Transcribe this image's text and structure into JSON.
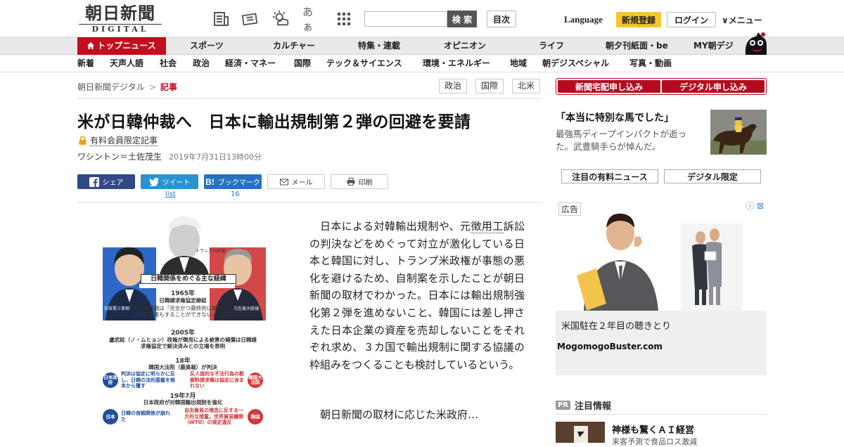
{
  "header": {
    "logo_main": "朝日新聞",
    "logo_sub": "DIGITAL",
    "search_placeholder": "",
    "search_button": "検 索",
    "toc_button": "目次",
    "language": "Language",
    "register": "新規登録",
    "login": "ログイン",
    "menu": "メニュー",
    "font_size_icon_text": "あぁ"
  },
  "main_nav": [
    "トップニュース",
    "スポーツ",
    "カルチャー",
    "特集・連載",
    "オピニオン",
    "ライフ",
    "朝夕刊紙面・be",
    "MY朝デジ"
  ],
  "sub_nav": [
    "新着",
    "天声人語",
    "社会",
    "政治",
    "経済・マネー",
    "国際",
    "テック＆サイエンス",
    "環境・エネルギー",
    "地域",
    "朝デジスペシャル",
    "写真・動画"
  ],
  "breadcrumb": {
    "home": "朝日新聞デジタル",
    "separator": ">",
    "current": "記事"
  },
  "tags": [
    "政治",
    "国際",
    "北米"
  ],
  "subscribe": {
    "newspaper": "新聞宅配申し込み",
    "digital": "デジタル申し込み"
  },
  "article": {
    "headline": "米が日韓仲裁へ　日本に輸出規制第２弾の回避を要請",
    "members_only": "有料会員限定記事",
    "byline": "ワシントン＝土佐茂生",
    "date": "2019年7月31日13時00分",
    "body_before_link": "日本による対韓輸出規制や、元",
    "body_link": "徴用工",
    "body_after_link": "訴訟の判決などをめぐって対立が激化している日本と韓国に対し、トランプ米政権が事態の悪化を避けるため、自制案を示したことが朝日新聞の取材でわかった。日本には輸出規制強化第２弾を進めないこと、韓国には差し押さえた日本企業の資産を売却しないことをそれぞれ求め、３カ国で輸出規制に関する協議の枠組みをつくることも検討しているという。",
    "body_continued": "朝日新聞の取材に応じた米政府…"
  },
  "share": {
    "facebook": "シェア",
    "twitter": "ツイート",
    "hatena": "ブックマーク",
    "mail": "メール",
    "print": "印刷",
    "twitter_count": "list",
    "hatena_count": "16"
  },
  "infographic": {
    "title": "日韓関係をめぐる主な経緯",
    "trump_label": "トランプ大統領",
    "abe_label": "安倍晋三首相",
    "moon_label": "文在寅大統領",
    "events": [
      {
        "year": "1965年",
        "text": "日韓請求権協定締結",
        "detail": "「請求権問題は『完全かつ最終的に解決』」「いかなる主張もすることができない」と確認"
      },
      {
        "year": "2005年",
        "text": "盧武鉉（ノ・ムヒョン）政権が徴用による被害の補償は日韓請求権協定で解決済みとの立場を表明",
        "detail": ""
      },
      {
        "year": "18年",
        "text": "韓国大法院（最高裁）が判決",
        "detail": ""
      },
      {
        "year": "19年7月",
        "text": "日本政府が対韓国輸出規制を強化",
        "detail": ""
      }
    ],
    "jp_gov": "日本政府",
    "jp_gov_short": "日本",
    "kr_court": "韓国大法院",
    "kr_short": "韓国",
    "jp_2018": "判決は協定に明らかに反し、日韓の法的基盤を根本から覆す",
    "kr_2018": "反人道的な不法行為の慰謝料請求権は協定に含まれない",
    "jp_2019": "日韓の信頼関係が崩れた",
    "kr_2019": "自由貿易の理念に反する一方的な措置。世界貿易機関（WTO）の規定違反"
  },
  "sidebar": {
    "promo_title": "「本当に特別な馬でした」",
    "promo_desc": "最強馬ディープインパクトが逝った。武豊騎手らが悼んだ。",
    "tab_premium": "注目の有料ニュース",
    "tab_digital": "デジタル限定",
    "ad_label": "広告",
    "ad_text": "米国駐在２年目の聴きとり",
    "ad_source": "MogomogoBuster.com",
    "pr_badge": "PR",
    "pr_heading": "注目情報",
    "pr_title": "神様も驚くＡＩ経営",
    "pr_sub": "来客予測で食品ロス激減"
  },
  "colors": {
    "brand_red": "#c40d1e",
    "nav_bg": "#e9e9e9",
    "register_yellow": "#f5c531",
    "facebook": "#2f4a86",
    "twitter": "#2a93cf",
    "hatena": "#2672c0"
  },
  "icons": [
    "newspaper-icon",
    "ticket-icon",
    "weather-icon",
    "font-size-icon",
    "grid-icon",
    "home-icon",
    "lock-icon",
    "facebook-icon",
    "twitter-icon",
    "hatena-icon",
    "mail-icon",
    "print-icon",
    "chevron-down-icon",
    "mascot-icon"
  ]
}
